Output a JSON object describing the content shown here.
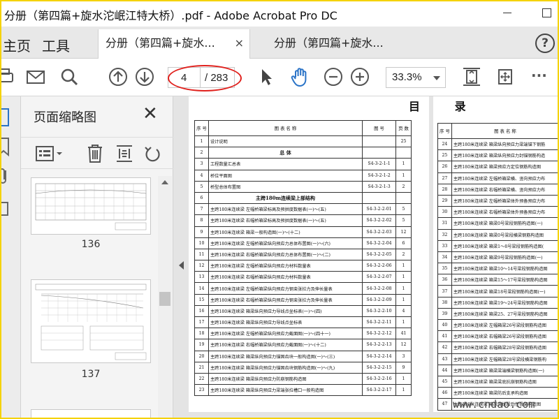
{
  "window": {
    "title": "分册（第四篇+旋水沱岷江特大桥）.pdf - Adobe Acrobat Pro DC"
  },
  "nav": {
    "home": "主页",
    "tools": "工具"
  },
  "tabs": [
    {
      "label": "分册（第四篇+旋水...",
      "close": "×"
    },
    {
      "label": "分册（第四篇+旋水..."
    }
  ],
  "help": "?",
  "toolbar": {
    "page_current": "4",
    "page_total": "/ 283",
    "zoom": "33.3%",
    "more": "···"
  },
  "panel": {
    "title": "页面缩略图",
    "close": "✕",
    "thumbs": [
      {
        "label": "136"
      },
      {
        "label": "137"
      }
    ]
  },
  "document": {
    "heading": "目  录",
    "columns": {
      "no": "序 号",
      "name": "图 表 名 称",
      "code": "图 号",
      "pages": "页 数"
    },
    "rows_left": [
      {
        "no": "1",
        "name": "设计说明",
        "code": "",
        "pages": "25"
      },
      {
        "no": "2",
        "name": "总 体",
        "code": "",
        "pages": "",
        "section": true
      },
      {
        "no": "3",
        "name": "工程数量汇总表",
        "code": "S4-3-2-1-1",
        "pages": "1"
      },
      {
        "no": "4",
        "name": "桥位平面图",
        "code": "S4-3-2-1-2",
        "pages": "1"
      },
      {
        "no": "5",
        "name": "桥型总体布置图",
        "code": "S4-3-2-1-3",
        "pages": "2"
      },
      {
        "no": "6",
        "name": "主跨180m连续梁上部结构",
        "code": "",
        "pages": "",
        "section": true
      },
      {
        "no": "7",
        "name": "主跨180米连续梁  左幅桥箱梁标高及预拱度数据表(一)～(五)",
        "code": "S4-3-2-2-01",
        "pages": "5"
      },
      {
        "no": "8",
        "name": "主跨180米连续梁  右幅桥箱梁标高及预拱度数据表(一)～(五)",
        "code": "S4-3-2-2-02",
        "pages": "5"
      },
      {
        "no": "9",
        "name": "主跨180米连续梁  箱梁一般构造图(一)～(十二)",
        "code": "S4-3-2-2-03",
        "pages": "12"
      },
      {
        "no": "10",
        "name": "主跨180米连续梁  左幅桥箱梁纵向预应力总体布置图(一)～(六)",
        "code": "S4-3-2-2-04",
        "pages": "6"
      },
      {
        "no": "11",
        "name": "主跨180米连续梁  右幅桥箱梁纵向预应力总体布置图(一)～(二)",
        "code": "S4-3-2-2-05",
        "pages": "2"
      },
      {
        "no": "12",
        "name": "主跨180米连续梁  左幅桥箱梁纵向预应力材料数量表",
        "code": "S4-3-2-2-06",
        "pages": "1"
      },
      {
        "no": "13",
        "name": "主跨180米连续梁  右幅桥箱梁纵向预应力材料数量表",
        "code": "S4-3-2-2-07",
        "pages": "1"
      },
      {
        "no": "14",
        "name": "主跨180米连续梁  左幅桥箱梁纵向预应力钢束张拉力及伸长量表",
        "code": "S4-3-2-2-08",
        "pages": "1"
      },
      {
        "no": "15",
        "name": "主跨180米连续梁  右幅桥箱梁纵向预应力钢束张拉力及伸长量表",
        "code": "S4-3-2-2-09",
        "pages": "1"
      },
      {
        "no": "16",
        "name": "主跨180米连续梁  箱梁纵向预应力导线点坐标表(一)～(四)",
        "code": "S4-3-2-2-10",
        "pages": "4"
      },
      {
        "no": "17",
        "name": "主跨180米连续梁  箱梁纵向预应力导线点坐标表",
        "code": "S4-3-2-2-11",
        "pages": "1"
      },
      {
        "no": "18",
        "name": "主跨180米连续梁  左幅桥箱梁纵向预应力截面图(一)～(四十一)",
        "code": "S4-3-2-2-12",
        "pages": "41"
      },
      {
        "no": "19",
        "name": "主跨180米连续梁  右幅桥箱梁纵向预应力截面图(一)～(十二)",
        "code": "S4-3-2-2-13",
        "pages": "12"
      },
      {
        "no": "20",
        "name": "主跨180米连续梁  箱梁纵向预应力锚固齿块一般构造图(一)～(三)",
        "code": "S4-3-2-2-14",
        "pages": "3"
      },
      {
        "no": "21",
        "name": "主跨180米连续梁  箱梁纵向预应力锚固齿块钢筋构造图(一)～(九)",
        "code": "S4-3-2-2-15",
        "pages": "9"
      },
      {
        "no": "22",
        "name": "主跨180米连续梁  箱梁纵向预应力防崩钢筋构造图",
        "code": "S4-3-2-2-16",
        "pages": "1"
      },
      {
        "no": "23",
        "name": "主跨180米连续梁  箱梁纵向预应力梁端张拉槽口一般构造图",
        "code": "S4-3-2-2-17",
        "pages": "1"
      }
    ],
    "rows_right": [
      {
        "no": "24",
        "name": "主跨180米连续梁  箱梁纵向预应力梁端锚下钢筋"
      },
      {
        "no": "25",
        "name": "主跨180米连续梁  箱梁纵向预应力封锚钢筋构造"
      },
      {
        "no": "26",
        "name": "主跨180米连续梁  箱梁预应力定位钢筋构造图"
      },
      {
        "no": "27",
        "name": "主跨180米连续梁  左幅桥箱梁横、竖向预应力布"
      },
      {
        "no": "28",
        "name": "主跨180米连续梁  右幅桥箱梁横、竖向预应力布"
      },
      {
        "no": "29",
        "name": "主跨180米连续梁  左幅桥箱梁体外预备预应力布"
      },
      {
        "no": "30",
        "name": "主跨180米连续梁  右幅桥箱梁体外预备预应力布"
      },
      {
        "no": "31",
        "name": "主跨180米连续梁  箱梁0号梁段钢筋构造图(一)"
      },
      {
        "no": "32",
        "name": "主跨180米连续梁  箱梁0号梁段横梁钢筋构造图"
      },
      {
        "no": "33",
        "name": "主跨180米连续梁  箱梁1～8号梁段钢筋构造图("
      },
      {
        "no": "34",
        "name": "主跨180米连续梁  箱梁9号梁段钢筋构造图(一)"
      },
      {
        "no": "35",
        "name": "主跨180米连续梁  箱梁10～14号梁段钢筋构造图"
      },
      {
        "no": "36",
        "name": "主跨180米连续梁  箱梁15～17号梁段钢筋构造图"
      },
      {
        "no": "37",
        "name": "主跨180米连续梁  箱梁18号梁段钢筋构造图(一)"
      },
      {
        "no": "38",
        "name": "主跨180米连续梁  箱梁19～24号梁段钢筋构造图"
      },
      {
        "no": "39",
        "name": "主跨180米连续梁  箱梁25、27号梁段钢筋构造图"
      },
      {
        "no": "40",
        "name": "主跨180米连续梁  左幅箱梁26号梁段钢筋构造图"
      },
      {
        "no": "41",
        "name": "主跨180米连续梁  右幅箱梁26号梁段钢筋构造图"
      },
      {
        "no": "42",
        "name": "主跨180米连续梁  右幅箱梁28号梁段钢筋构造图"
      },
      {
        "no": "43",
        "name": "主跨180米连续梁  左幅箱梁28号梁段横梁钢筋构"
      },
      {
        "no": "44",
        "name": "主跨180米连续梁  箱梁梁端横梁钢筋构造图(一)"
      },
      {
        "no": "45",
        "name": "主跨180米连续梁  箱梁梁底抗崩钢筋构造图"
      },
      {
        "no": "46",
        "name": "主跨180米连续梁  箱梁防后支承构造图"
      },
      {
        "no": "47",
        "name": "主跨180米连续梁  箱梁合拢段劲性骨架构造图"
      }
    ]
  },
  "watermark": "www.cndao.com",
  "colors": {
    "annotation_oval": "#e0201c",
    "frame": "#f5d200",
    "hand_tool": "#2a73c7"
  }
}
